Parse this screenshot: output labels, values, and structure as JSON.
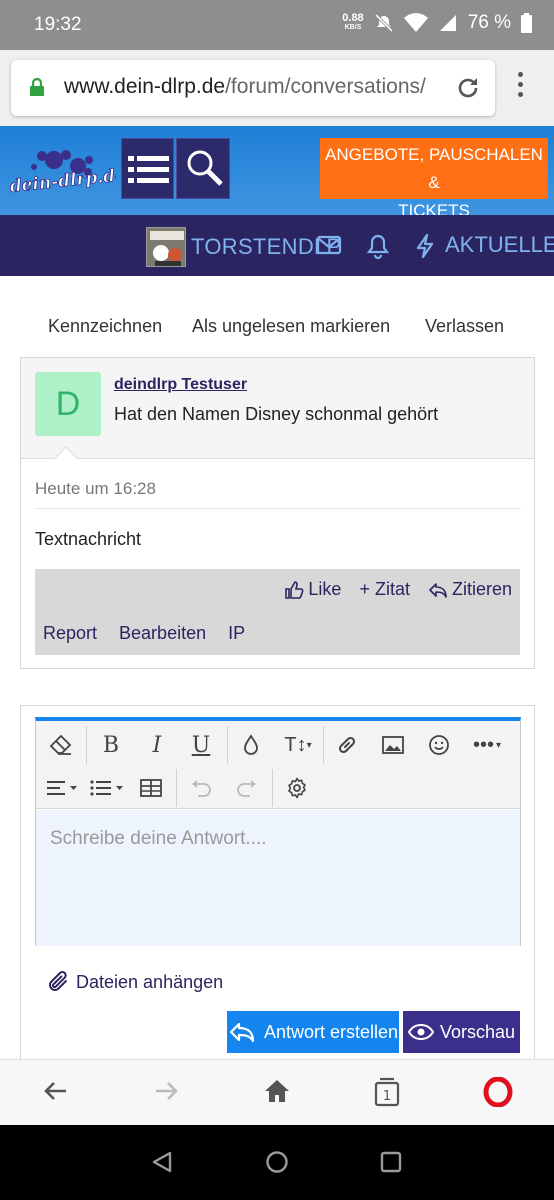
{
  "status": {
    "time": "19:32",
    "kbs_value": "0.88",
    "kbs_unit": "KB/S",
    "battery": "76 %"
  },
  "browser": {
    "url_domain": "www.dein-dlrp.de",
    "url_path": "/forum/conversations/"
  },
  "site": {
    "logo_text": "dein-dlrp.de",
    "promo_line1": "ANGEBOTE, PAUSCHALEN &",
    "promo_line2": "TICKETS",
    "username": "TORSTENDLP",
    "aktuelles": "AKTUELLES"
  },
  "conversation_actions": [
    "Kennzeichnen",
    "Als ungelesen markieren",
    "Verlassen"
  ],
  "message": {
    "avatar_letter": "D",
    "author": "deindlrp Testuser",
    "title": "Hat den Namen Disney schonmal gehört",
    "date": "Heute um 16:28",
    "body": "Textnachricht",
    "like_label": "Like",
    "zitat_label": "+ Zitat",
    "zitieren_label": "Zitieren",
    "report_label": "Report",
    "edit_label": "Bearbeiten",
    "ip_label": "IP"
  },
  "editor": {
    "placeholder": "Schreibe deine Antwort....",
    "attach_label": "Dateien anhängen",
    "reply_label": "Antwort erstellen",
    "preview_label": "Vorschau"
  },
  "colors": {
    "header_blue": "#1f7fd6",
    "nav_dark": "#2a2560",
    "promo_orange": "#ff6f14",
    "button_blue": "#1485ee",
    "button_purple": "#3b2f8c"
  }
}
